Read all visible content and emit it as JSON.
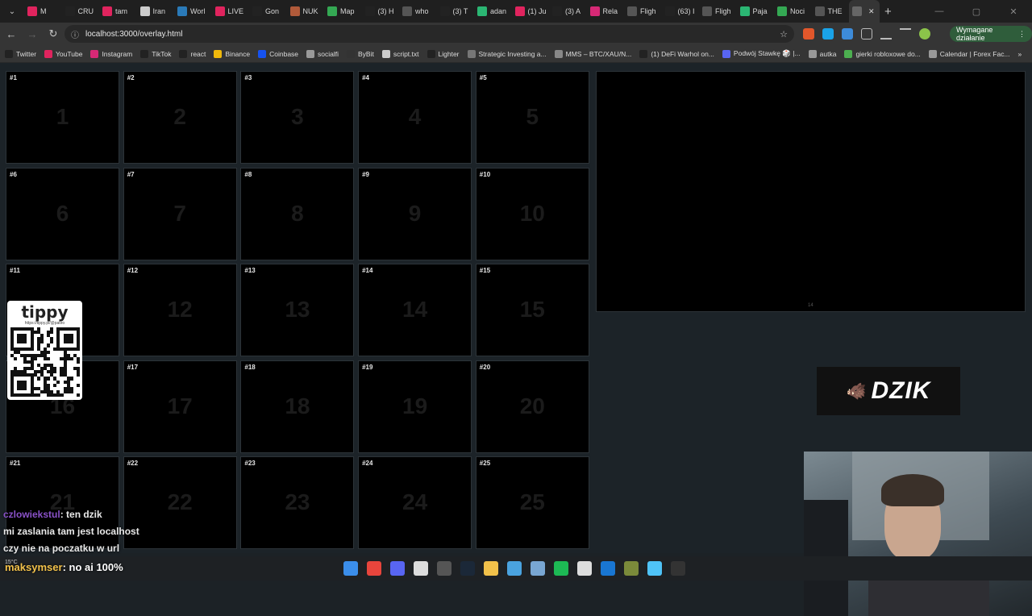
{
  "browser": {
    "tabs": [
      {
        "label": "M",
        "color": "#e0245e"
      },
      {
        "label": "CRU",
        "color": "#222"
      },
      {
        "label": "tam",
        "color": "#e0245e"
      },
      {
        "label": "Iran",
        "color": "#ccc"
      },
      {
        "label": "Worl",
        "color": "#2a7ab8"
      },
      {
        "label": "LIVE",
        "color": "#e0245e"
      },
      {
        "label": "Gon",
        "color": "#222"
      },
      {
        "label": "NUK",
        "color": "#b05a3a"
      },
      {
        "label": "Map",
        "color": "#34a853"
      },
      {
        "label": "(3) H",
        "color": "#222"
      },
      {
        "label": "who",
        "color": "#555"
      },
      {
        "label": "(3) T",
        "color": "#222"
      },
      {
        "label": "adan",
        "color": "#2bb673"
      },
      {
        "label": "(1) Ju",
        "color": "#e0245e"
      },
      {
        "label": "(3) A",
        "color": "#222"
      },
      {
        "label": "Rela",
        "color": "#d62976"
      },
      {
        "label": "Fligh",
        "color": "#555"
      },
      {
        "label": "(63) I",
        "color": "#222"
      },
      {
        "label": "Fligh",
        "color": "#555"
      },
      {
        "label": "Paja",
        "color": "#2bb673"
      },
      {
        "label": "Noci",
        "color": "#34a853"
      },
      {
        "label": "THE",
        "color": "#555"
      },
      {
        "label": "",
        "color": "#666"
      }
    ],
    "url": "localhost:3000/overlay.html",
    "action_button": "Wymagane działanie",
    "bookmarks": [
      {
        "label": "Twitter",
        "color": "#222"
      },
      {
        "label": "YouTube",
        "color": "#e0245e"
      },
      {
        "label": "Instagram",
        "color": "#d62976"
      },
      {
        "label": "TikTok",
        "color": "#222"
      },
      {
        "label": "react",
        "color": "#222"
      },
      {
        "label": "Binance",
        "color": "#f0b90b"
      },
      {
        "label": "Coinbase",
        "color": "#1652f0"
      },
      {
        "label": "socialfi",
        "color": "#999"
      },
      {
        "label": "ByBit",
        "color": "#333"
      },
      {
        "label": "script.txt",
        "color": "#ccc"
      },
      {
        "label": "Lighter",
        "color": "#222"
      },
      {
        "label": "Strategic Investing a...",
        "color": "#777"
      },
      {
        "label": "MMS – BTC/XAU/N...",
        "color": "#888"
      },
      {
        "label": "(1) DeFi Warhol on...",
        "color": "#222"
      },
      {
        "label": "Podwój Stawkę 🎲 |...",
        "color": "#5865f2"
      },
      {
        "label": "autka",
        "color": "#999"
      },
      {
        "label": "gierki robloxowe do...",
        "color": "#4caf50"
      },
      {
        "label": "Calendar | Forex Fac...",
        "color": "#999"
      }
    ]
  },
  "overlay": {
    "slots": [
      {
        "tag": "#1",
        "big": "1"
      },
      {
        "tag": "#2",
        "big": "2"
      },
      {
        "tag": "#3",
        "big": "3"
      },
      {
        "tag": "#4",
        "big": "4"
      },
      {
        "tag": "#5",
        "big": "5"
      },
      {
        "tag": "#6",
        "big": "6"
      },
      {
        "tag": "#7",
        "big": "7"
      },
      {
        "tag": "#8",
        "big": "8"
      },
      {
        "tag": "#9",
        "big": "9"
      },
      {
        "tag": "#10",
        "big": "10"
      },
      {
        "tag": "#11",
        "big": "11"
      },
      {
        "tag": "#12",
        "big": "12"
      },
      {
        "tag": "#13",
        "big": "13"
      },
      {
        "tag": "#14",
        "big": "14"
      },
      {
        "tag": "#15",
        "big": "15"
      },
      {
        "tag": "#16",
        "big": "16"
      },
      {
        "tag": "#17",
        "big": "17"
      },
      {
        "tag": "#18",
        "big": "18"
      },
      {
        "tag": "#19",
        "big": "19"
      },
      {
        "tag": "#20",
        "big": "20"
      },
      {
        "tag": "#21",
        "big": "21"
      },
      {
        "tag": "#22",
        "big": "22"
      },
      {
        "tag": "#23",
        "big": "23"
      },
      {
        "tag": "#24",
        "big": "24"
      },
      {
        "tag": "#25",
        "big": "25"
      }
    ],
    "preview_label": "14"
  },
  "tippy": {
    "title": "tippy",
    "url": "https://tippy.pl/@patiro"
  },
  "dzik": {
    "logo_text": "DZIK"
  },
  "chat": {
    "messages": [
      {
        "user": "czlowiekstul",
        "text": ": ten dzik"
      },
      {
        "user": "",
        "text": "mi zaslania tam jest localhost"
      },
      {
        "user": "",
        "text": "czy nie na poczatku w url"
      }
    ],
    "bottom": {
      "user": "maksymser",
      "text": ": no ai 100%"
    }
  },
  "taskbar": {
    "weather": "15°C",
    "apps": [
      {
        "name": "windows-icon",
        "color": "#3b8eea"
      },
      {
        "name": "chrome-icon",
        "color": "#e8453c"
      },
      {
        "name": "discord-icon",
        "color": "#5865f2"
      },
      {
        "name": "app-icon",
        "color": "#ddd"
      },
      {
        "name": "obs-icon",
        "color": "#555"
      },
      {
        "name": "steam-icon",
        "color": "#1b2838"
      },
      {
        "name": "folder-icon",
        "color": "#f2c14a"
      },
      {
        "name": "app-icon-2",
        "color": "#4aa3df"
      },
      {
        "name": "app-icon-3",
        "color": "#79a6d2"
      },
      {
        "name": "spotify-icon",
        "color": "#1db954"
      },
      {
        "name": "app-icon-4",
        "color": "#ddd"
      },
      {
        "name": "app-icon-5",
        "color": "#1976d2"
      },
      {
        "name": "app-icon-6",
        "color": "#7b8a3a"
      },
      {
        "name": "notepad-icon",
        "color": "#4fc3f7"
      },
      {
        "name": "terminal-icon",
        "color": "#333"
      }
    ]
  }
}
